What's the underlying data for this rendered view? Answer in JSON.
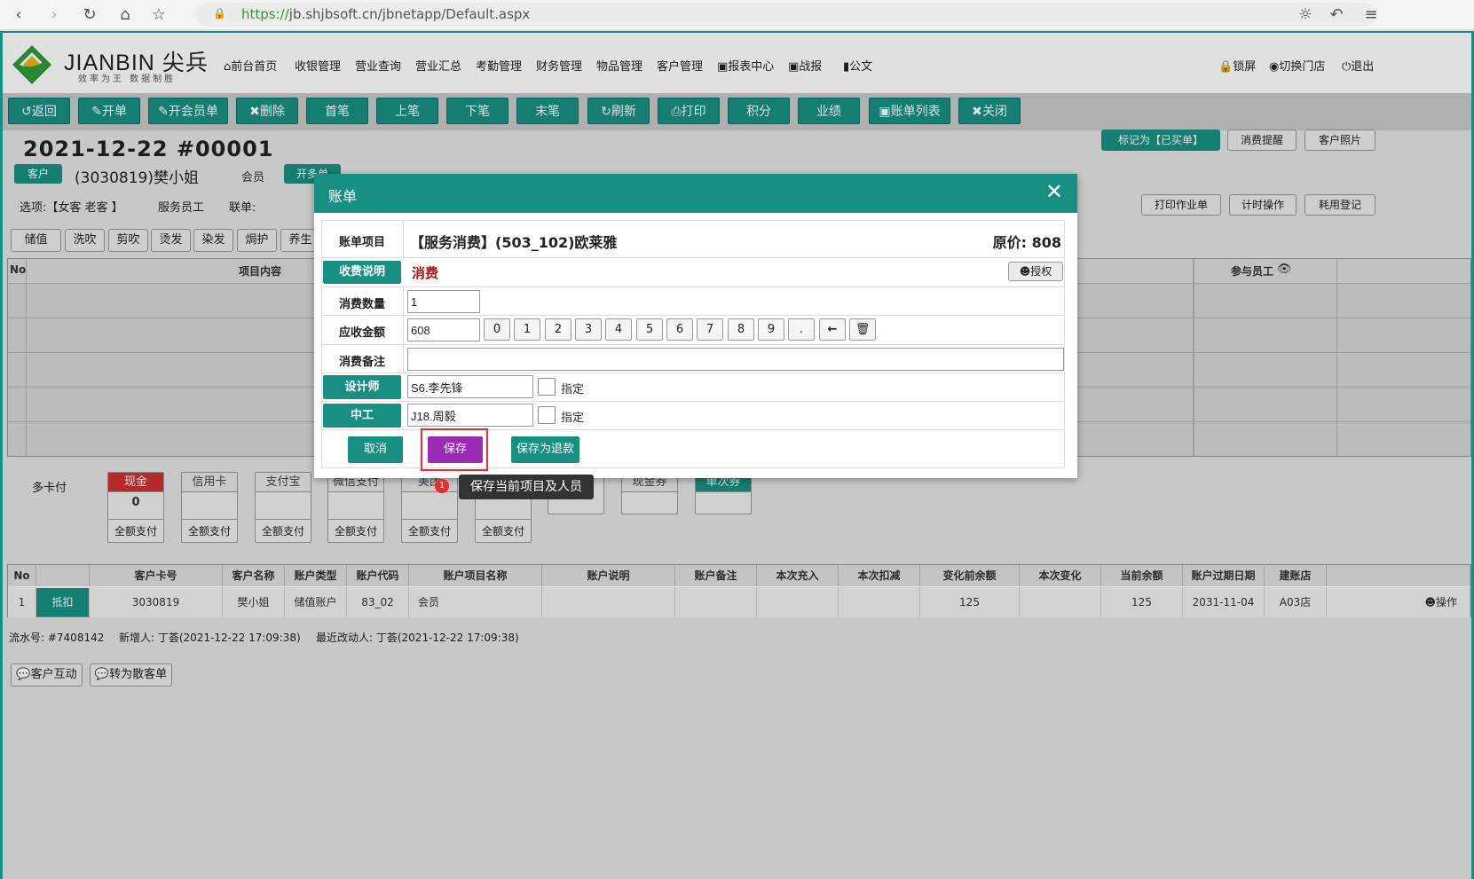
{
  "browser": {
    "url_scheme": "https://",
    "url_rest": "jb.shjbsoft.cn/jbnetapp/Default.aspx"
  },
  "logo": {
    "name": "JIANBIN 尖兵",
    "slogan": "效率为王 数据制胜"
  },
  "nav": [
    "前台首页",
    "收银管理",
    "营业查询",
    "营业汇总",
    "考勤管理",
    "财务管理",
    "物品管理",
    "客户管理",
    "报表中心",
    "战报",
    "公文"
  ],
  "nav_right": [
    "锁屏",
    "切换门店",
    "退出"
  ],
  "toolbar": [
    "返回",
    "开单",
    "开会员单",
    "删除",
    "首笔",
    "上笔",
    "下笔",
    "末笔",
    "刷新",
    "打印",
    "积分",
    "业绩",
    "账单列表",
    "关闭"
  ],
  "bill": {
    "date_no": "2021-12-22  #00001",
    "customer_badge": "客户",
    "customer_name": "(3030819)樊小姐",
    "member_label": "会员",
    "open_badge": "开多单",
    "options": "选项:【女客 老客 】",
    "service_staff": "服务员工",
    "joint": "联单:",
    "mark_bought": "标记为【已买单】",
    "remind": "消费提醒",
    "photo": "客户照片",
    "print_job": "打印作业单",
    "timer": "计时操作",
    "usage": "耗用登记"
  },
  "service_tabs": [
    "储值",
    "洗吹",
    "剪吹",
    "烫发",
    "染发",
    "焗护",
    "养生"
  ],
  "items_table": {
    "no": "No",
    "content": "项目内容",
    "staff": "参与员工"
  },
  "payments": {
    "multi_card": "多卡付",
    "methods": [
      {
        "label": "现金",
        "value": "0",
        "foot": "全额支付"
      },
      {
        "label": "信用卡",
        "value": "",
        "foot": "全额支付"
      },
      {
        "label": "支付宝",
        "value": "",
        "foot": "全额支付"
      },
      {
        "label": "微信支付",
        "value": "",
        "foot": "全额支付"
      },
      {
        "label": "美团",
        "value": "",
        "foot": "全额支付"
      },
      {
        "label": "",
        "value": "",
        "foot": "全额支付"
      },
      {
        "label": "",
        "value": "",
        "foot": ""
      },
      {
        "label": "现金券",
        "value": "",
        "foot": ""
      },
      {
        "label": "单次券",
        "value": "",
        "foot": ""
      }
    ]
  },
  "account_table": {
    "headers": [
      "No",
      "",
      "客户卡号",
      "客户名称",
      "账户类型",
      "账户代码",
      "账户项目名称",
      "账户说明",
      "账户备注",
      "本次充入",
      "本次扣减",
      "变化前余额",
      "本次变化",
      "当前余额",
      "账户过期日期",
      "建账店",
      ""
    ],
    "row": [
      "1",
      "抵扣",
      "3030819",
      "樊小姐",
      "储值账户",
      "83_02",
      "会员",
      "",
      "",
      "",
      "",
      "125",
      "",
      "125",
      "2031-11-04",
      "A03店",
      "操作"
    ]
  },
  "footer": {
    "serial": "流水号: #7408142",
    "created": "新增人: 丁荟(2021-12-22 17:09:38)",
    "modified": "最近改动人: 丁荟(2021-12-22 17:09:38)",
    "interact": "客户互动",
    "to_scatter": "转为散客单"
  },
  "modal": {
    "title": "账单",
    "item_label": "账单项目",
    "item_value": "【服务消费】(503_102)欧莱雅",
    "price": "原价: 808",
    "charge_label": "收费说明",
    "charge_value": "消费",
    "authorize": "授权",
    "qty_label": "消费数量",
    "qty_value": "1",
    "amount_label": "应收金额",
    "amount_value": "608",
    "keys": [
      "0",
      "1",
      "2",
      "3",
      "4",
      "5",
      "6",
      "7",
      "8",
      "9",
      "."
    ],
    "remark_label": "消费备注",
    "remark_value": "",
    "designer_label": "设计师",
    "designer_value": "S6.李先锋",
    "assistant_label": "中工",
    "assistant_value": "J18.周毅",
    "assign": "指定",
    "cancel": "取消",
    "save": "保存",
    "save_refund": "保存为退款",
    "tooltip": "保存当前项目及人员",
    "tip_no": "1"
  }
}
